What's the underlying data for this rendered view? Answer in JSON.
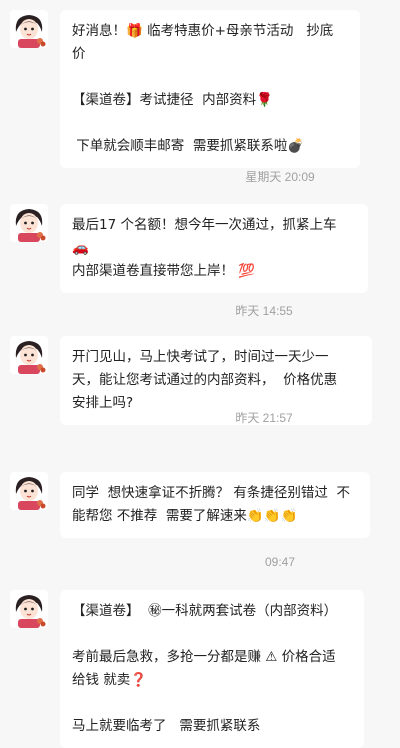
{
  "messages": [
    {
      "lines": [
        "好消息！🎁 临考特惠价+母亲节活动   抄底",
        "价",
        "",
        "【渠道卷】考试捷径  内部资料🌹",
        "",
        " 下单就会顺丰邮寄  需要抓紧联系啦💣"
      ]
    },
    {
      "timestamp": "星期天 20:09",
      "lines": [
        "最后17 个名额！想今年一次通过，抓紧上车",
        "🚗",
        "内部渠道卷直接带您上岸！ 💯"
      ]
    },
    {
      "timestamp": "昨天 14:55",
      "lines": [
        "开门见山，马上快考试了，时间过一天少一",
        "天，能让您考试通过的内部资料，  价格优惠",
        "安排上吗?"
      ]
    },
    {
      "timestamp": "昨天 21:57",
      "lines": [
        "同学  想快速拿证不折腾？ 有条捷径别错过  不",
        "能帮您 不推荐  需要了解速来👏👏👏"
      ]
    },
    {
      "timestamp": "09:47",
      "lines": [
        "【渠道卷】  ㊙一科就两套试卷（内部资料）",
        "",
        "考前最后急救，多抢一分都是赚 ⚠ 价格合适",
        "给钱 就卖❓",
        "",
        "马上就要临考了   需要抓紧联系"
      ]
    }
  ],
  "colors": {
    "background": "#f7f7f7",
    "bubble": "#ffffff",
    "timestamp": "#a0a0a0"
  },
  "icons": {
    "avatar": "cartoon-girl-avatar"
  }
}
